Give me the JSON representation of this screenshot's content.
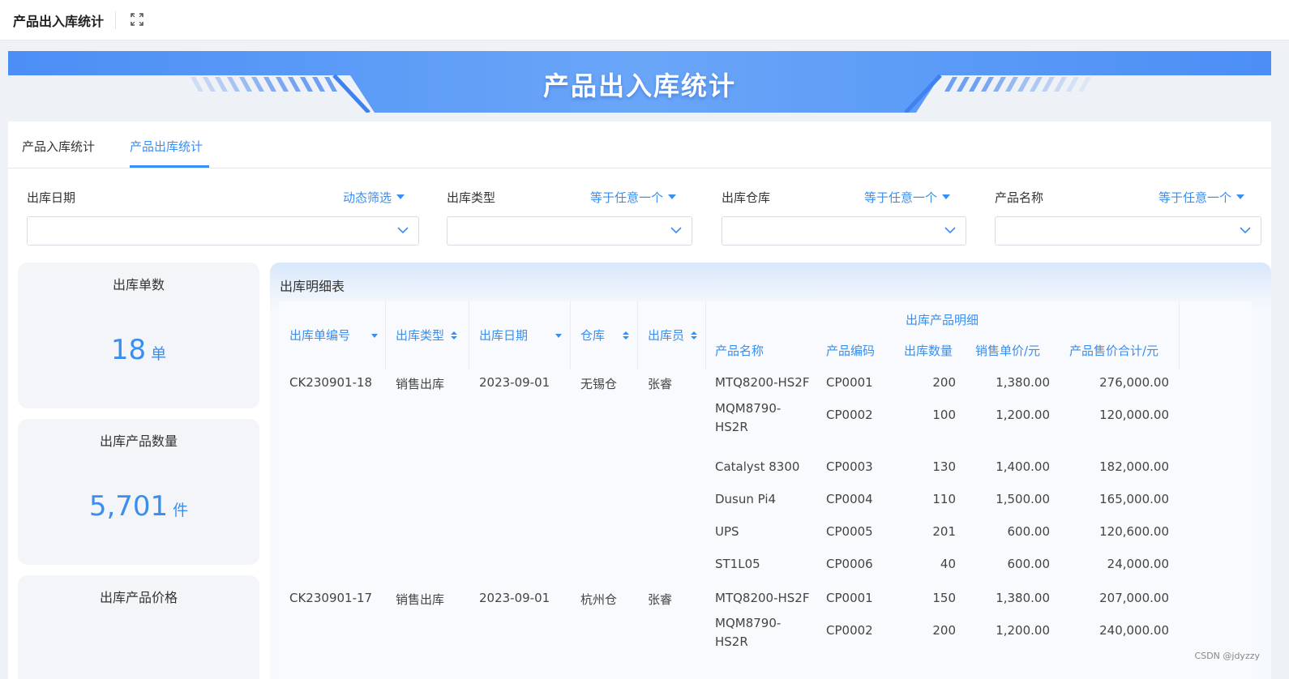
{
  "topbar": {
    "title": "产品出入库统计",
    "expand_icon": "expand-icon"
  },
  "banner": {
    "title": "产品出入库统计",
    "accent": "#3a8ef0"
  },
  "tabs": [
    {
      "label": "产品入库统计",
      "active": false
    },
    {
      "label": "产品出库统计",
      "active": true
    }
  ],
  "filters": [
    {
      "label": "出库日期",
      "mode": "动态筛选",
      "value": ""
    },
    {
      "label": "出库类型",
      "mode": "等于任意一个",
      "value": ""
    },
    {
      "label": "出库仓库",
      "mode": "等于任意一个",
      "value": ""
    },
    {
      "label": "产品名称",
      "mode": "等于任意一个",
      "value": ""
    }
  ],
  "kpis": [
    {
      "label": "出库单数",
      "value": "18",
      "unit": "单"
    },
    {
      "label": "出库产品数量",
      "value": "5,701",
      "unit": "件"
    },
    {
      "label": "出库产品价格",
      "value": "",
      "unit": ""
    }
  ],
  "table": {
    "title": "出库明细表",
    "group_header": "出库产品明细",
    "columns": [
      "出库单编号",
      "出库类型",
      "出库日期",
      "仓库",
      "出库员",
      "产品名称",
      "产品编码",
      "出库数量",
      "销售单价/元",
      "产品售价合计/元"
    ],
    "orders": [
      {
        "id": "CK230901-18",
        "type": "销售出库",
        "date": "2023-09-01",
        "warehouse": "无锡仓",
        "staff": "张睿",
        "items": [
          {
            "name": "MTQ8200-HS2F",
            "code": "CP0001",
            "qty": "200",
            "price": "1,380.00",
            "total": "276,000.00"
          },
          {
            "name": "MQM8790-HS2R",
            "code": "CP0002",
            "qty": "100",
            "price": "1,200.00",
            "total": "120,000.00"
          },
          {
            "name": "Catalyst 8300",
            "code": "CP0003",
            "qty": "130",
            "price": "1,400.00",
            "total": "182,000.00"
          },
          {
            "name": "Dusun Pi4",
            "code": "CP0004",
            "qty": "110",
            "price": "1,500.00",
            "total": "165,000.00"
          },
          {
            "name": "UPS",
            "code": "CP0005",
            "qty": "201",
            "price": "600.00",
            "total": "120,600.00"
          },
          {
            "name": "ST1L05",
            "code": "CP0006",
            "qty": "40",
            "price": "600.00",
            "total": "24,000.00"
          }
        ]
      },
      {
        "id": "CK230901-17",
        "type": "销售出库",
        "date": "2023-09-01",
        "warehouse": "杭州仓",
        "staff": "张睿",
        "items": [
          {
            "name": "MTQ8200-HS2F",
            "code": "CP0001",
            "qty": "150",
            "price": "1,380.00",
            "total": "207,000.00"
          },
          {
            "name": "MQM8790-HS2R",
            "code": "CP0002",
            "qty": "200",
            "price": "1,200.00",
            "total": "240,000.00"
          }
        ]
      }
    ]
  },
  "watermark": "CSDN @jdyzzy"
}
